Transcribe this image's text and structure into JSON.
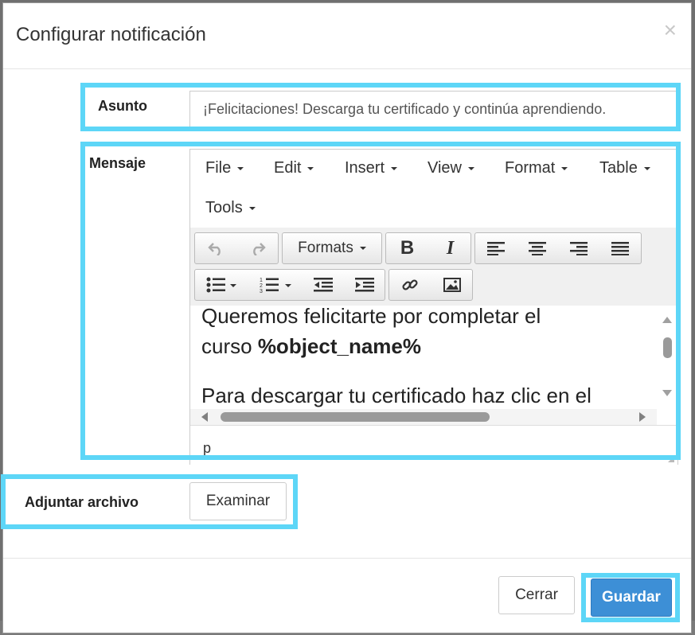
{
  "modal": {
    "title": "Configurar notificación",
    "close_glyph": "×"
  },
  "form": {
    "subject_label": "Asunto",
    "subject_value": "¡Felicitaciones! Descarga tu certificado y continúa aprendiendo.",
    "message_label": "Mensaje",
    "attach_label": "Adjuntar archivo",
    "browse_button": "Examinar"
  },
  "editor": {
    "menu": [
      "File",
      "Edit",
      "Insert",
      "View",
      "Format",
      "Table",
      "Tools"
    ],
    "toolbar": {
      "formats_label": "Formats",
      "bold": "B",
      "italic": "I",
      "icons": [
        "undo-icon",
        "redo-icon",
        "bold-icon",
        "italic-icon",
        "align-left-icon",
        "align-center-icon",
        "align-right-icon",
        "align-justify-icon",
        "bullet-list-icon",
        "numbered-list-icon",
        "outdent-icon",
        "indent-icon",
        "link-icon",
        "image-icon"
      ]
    },
    "content": {
      "line1": "Queremos felicitarte por completar el",
      "line2_prefix": "curso ",
      "line2_bold": "%object_name%",
      "line3": "Para descargar tu certificado haz clic en el"
    },
    "status_path": "p"
  },
  "footer": {
    "cancel_button": "Cerrar",
    "save_button": "Guardar"
  },
  "colors": {
    "highlight": "#5dd6f7",
    "primary": "#3d8fd6"
  }
}
